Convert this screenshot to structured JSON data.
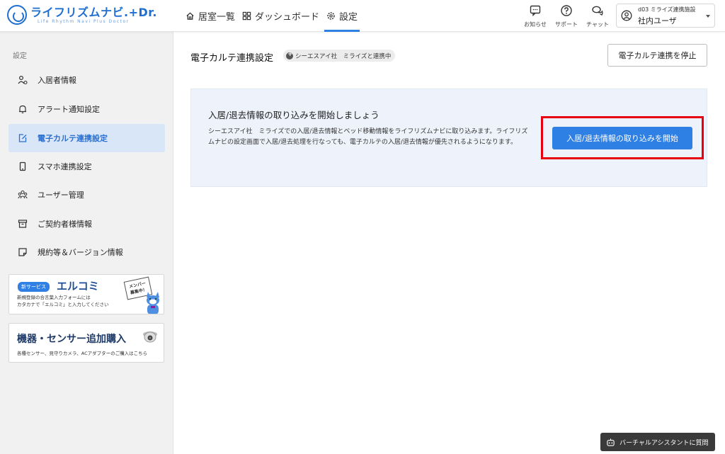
{
  "header": {
    "logo_main": "ライフリズムナビ.+Dr.",
    "logo_sub": "Life Rhythm Navi  Plus Doctor",
    "nav": [
      {
        "label": "居室一覧"
      },
      {
        "label": "ダッシュボード"
      },
      {
        "label": "設定"
      }
    ],
    "icons": [
      {
        "label": "お知らせ"
      },
      {
        "label": "サポート"
      },
      {
        "label": "チャット"
      }
    ],
    "user": {
      "facility": "d03 ミライズ連携施設",
      "role": "社内ユーザ"
    }
  },
  "sidebar": {
    "title": "設定",
    "items": [
      {
        "label": "入居者情報"
      },
      {
        "label": "アラート通知設定"
      },
      {
        "label": "電子カルテ連携設定"
      },
      {
        "label": "スマホ連携設定"
      },
      {
        "label": "ユーザー管理"
      },
      {
        "label": "ご契約者様情報"
      },
      {
        "label": "規約等＆バージョン情報"
      }
    ],
    "banner1": {
      "badge": "新サービス",
      "title": "エルコミ",
      "desc1": "新規登録の合言葉入力フォームには",
      "desc2": "カタカナで「エルコミ」と入力してください",
      "sign1": "メンバー",
      "sign2": "募集中！"
    },
    "banner2": {
      "title": "機器・センサー追加購入",
      "desc": "各種センサー、見守りカメラ、ACアダプターのご購入はこちら"
    }
  },
  "main": {
    "title": "電子カルテ連携設定",
    "link_status": "シーエスアイ社　ミライズと連携中",
    "stop_button": "電子カルテ連携を停止",
    "card": {
      "heading": "入居/退去情報の取り込みを開始しましょう",
      "desc": "シーエスアイ社　ミライズでの入居/退去情報とベッド移動情報をライフリズムナビに取り込みます。ライフリズムナビの設定画面で入居/退去処理を行なっても、電子カルテの入居/退去情報が優先されるようになります。",
      "start_button": "入居/退去情報の取り込みを開始"
    }
  },
  "assistant": {
    "label": "バーチャルアシスタントに質問"
  },
  "colors": {
    "accent": "#2f80e4",
    "highlight": "#e60012",
    "brand": "#1e6fd0"
  }
}
